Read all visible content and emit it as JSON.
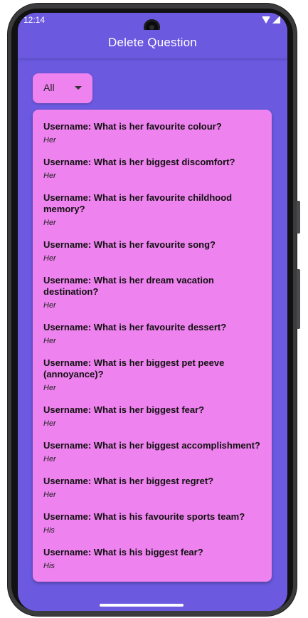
{
  "status_bar": {
    "time": "12:14",
    "icons": [
      "wifi-icon",
      "signal-icon"
    ]
  },
  "app_bar": {
    "title": "Delete Question"
  },
  "filter": {
    "selected": "All"
  },
  "questions": [
    {
      "text": "Username: What is her favourite colour?",
      "gender": "Her"
    },
    {
      "text": "Username: What is her biggest discomfort?",
      "gender": "Her"
    },
    {
      "text": "Username: What is her favourite childhood memory?",
      "gender": "Her"
    },
    {
      "text": "Username: What is her favourite song?",
      "gender": "Her"
    },
    {
      "text": "Username: What is her dream vacation destination?",
      "gender": "Her"
    },
    {
      "text": "Username: What is her favourite dessert?",
      "gender": "Her"
    },
    {
      "text": "Username: What is her biggest pet peeve (annoyance)?",
      "gender": "Her"
    },
    {
      "text": "Username: What is her biggest fear?",
      "gender": "Her"
    },
    {
      "text": "Username: What is her biggest accomplishment?",
      "gender": "Her"
    },
    {
      "text": "Username: What is her biggest regret?",
      "gender": "Her"
    },
    {
      "text": "Username: What is his favourite sports team?",
      "gender": "His"
    },
    {
      "text": "Username: What is his biggest fear?",
      "gender": "His"
    }
  ],
  "colors": {
    "primary": "#6b5ae0",
    "card": "#ee82ee"
  }
}
